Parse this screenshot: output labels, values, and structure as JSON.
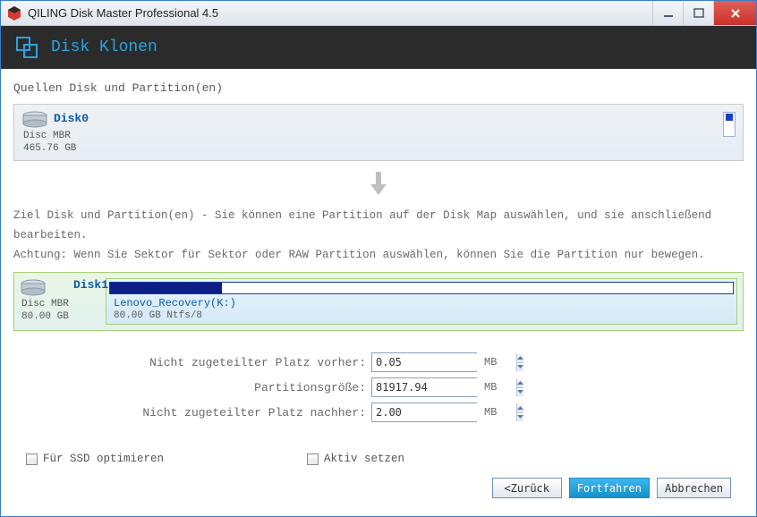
{
  "window": {
    "title": "QILING Disk Master Professional 4.5"
  },
  "header": {
    "title": "Disk Klonen"
  },
  "source": {
    "section_label": "Quellen Disk und Partition(en)",
    "disk_name": "Disk0",
    "disk_type": "Disc MBR",
    "disk_size": "465.76 GB"
  },
  "target": {
    "desc_line1": "Ziel Disk und Partition(en) - Sie können eine Partition auf der Disk Map auswählen, und sie anschließend bearbeiten.",
    "desc_line2": "Achtung: Wenn Sie Sektor für Sektor oder RAW Partition auswählen, können Sie die Partition nur bewegen.",
    "disk_name": "Disk1",
    "disk_type": "Disc MBR",
    "disk_size": "80.00 GB",
    "partition_label": "Lenovo_Recovery(K:)",
    "partition_detail": "80.00 GB Ntfs/8"
  },
  "form": {
    "before_label": "Nicht zugeteilter Platz vorher:",
    "before_value": "0.05",
    "size_label": "Partitionsgröße:",
    "size_value": "81917.94",
    "after_label": "Nicht zugeteilter Platz nachher:",
    "after_value": "2.00",
    "unit": "MB"
  },
  "checks": {
    "ssd": "Für SSD optimieren",
    "active": "Aktiv setzen"
  },
  "buttons": {
    "back": "<Zurück",
    "next": "Fortfahren",
    "cancel": "Abbrechen"
  }
}
